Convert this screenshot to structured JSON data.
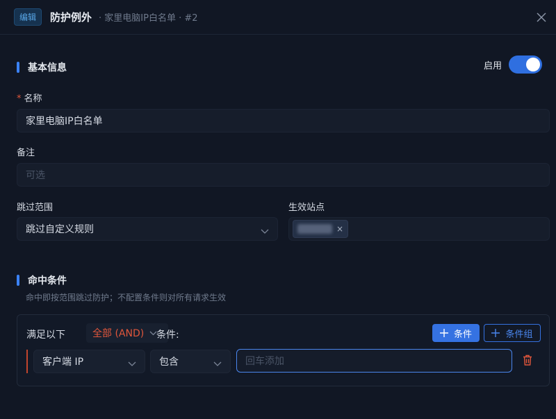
{
  "header": {
    "badge": "编辑",
    "title": "防护例外",
    "subtitle": "· 家里电脑IP白名单 · #2"
  },
  "basic": {
    "section_title": "基本信息",
    "toggle_label": "启用",
    "toggle_on": true
  },
  "fields": {
    "name_required": "*",
    "name_label": "名称",
    "name_value": "家里电脑IP白名单",
    "note_label": "备注",
    "note_placeholder": "可选",
    "scope_label": "跳过范围",
    "scope_value": "跳过自定义规则",
    "sites_label": "生效站点",
    "site_tag_remove": "×"
  },
  "conditions": {
    "section_title": "命中条件",
    "hint": "命中即按范围跳过防护；不配置条件则对所有请求生效",
    "satisfy_label": "满足以下",
    "mode_value": "全部 (AND)",
    "cond_suffix": "条件:",
    "add_condition": "条件",
    "add_group": "条件组",
    "row": {
      "field": "客户端 IP",
      "operator": "包含",
      "value_placeholder": "回车添加"
    }
  },
  "colors": {
    "accent": "#3572e2",
    "danger": "#e0563b",
    "background": "#111724"
  }
}
